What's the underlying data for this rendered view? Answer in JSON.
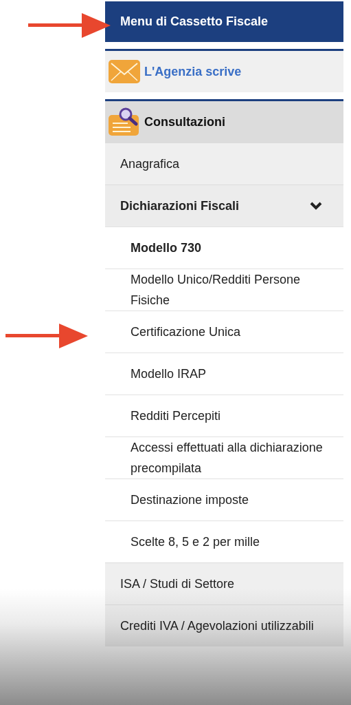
{
  "menu_title": "Menu di Cassetto Fiscale",
  "title_arrow": true,
  "sections": [
    {
      "label": "L'Agenzia scrive",
      "kind": "mail"
    },
    {
      "label": "Consultazioni",
      "kind": "search"
    }
  ],
  "items": [
    {
      "label": "Anagrafica"
    },
    {
      "label": "Dichiarazioni Fiscali",
      "expanded": true,
      "children": [
        {
          "label": "Modello 730",
          "selected": true,
          "arrow": false
        },
        {
          "label": "Modello Unico/Redditi Persone Fisiche",
          "selected": false,
          "arrow": false
        },
        {
          "label": "Certificazione Unica",
          "selected": false,
          "arrow": true
        },
        {
          "label": "Modello IRAP",
          "selected": false,
          "arrow": false
        },
        {
          "label": "Redditi Percepiti",
          "selected": false,
          "arrow": false
        },
        {
          "label": "Accessi effettuati alla dichiarazione precompilata",
          "selected": false,
          "arrow": false
        },
        {
          "label": "Destinazione imposte",
          "selected": false,
          "arrow": false
        },
        {
          "label": "Scelte 8, 5 e 2 per mille",
          "selected": false,
          "arrow": false
        }
      ]
    },
    {
      "label": "ISA / Studi di Settore"
    },
    {
      "label": "Crediti IVA / Agevolazioni utilizzabili"
    }
  ]
}
